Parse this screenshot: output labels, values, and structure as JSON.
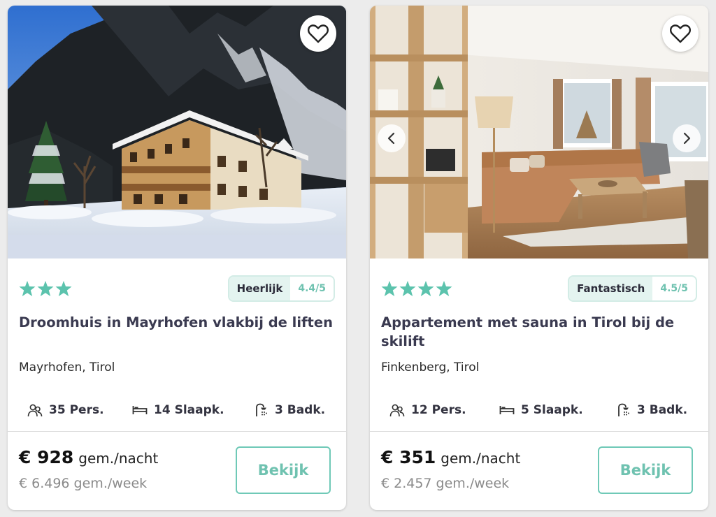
{
  "theme": {
    "accent": "#6fc2b0",
    "star_color": "#5cc3ad",
    "badge_bg": "#e4f4f0"
  },
  "cards": [
    {
      "stars": 3,
      "rating_word": "Heerlijk",
      "rating_score": "4.4/5",
      "title": "Droomhuis in Mayrhofen vlakbij de liften",
      "location": "Mayrhofen, Tirol",
      "persons": "35 Pers.",
      "bedrooms": "14 Slaapk.",
      "bathrooms": "3 Badk.",
      "price_amount": "€ 928",
      "price_unit": "gem./nacht",
      "price_week": "€ 6.496 gem./week",
      "cta": "Bekijk",
      "photo": "snowy-chalet",
      "has_carousel_arrows": false,
      "favorite_icon": "heart-outline-icon"
    },
    {
      "stars": 4,
      "rating_word": "Fantastisch",
      "rating_score": "4.5/5",
      "title": "Appartement met sauna in Tirol bij de skilift",
      "location": "Finkenberg, Tirol",
      "persons": "12 Pers.",
      "bedrooms": "5 Slaapk.",
      "bathrooms": "3 Badk.",
      "price_amount": "€ 351",
      "price_unit": "gem./nacht",
      "price_week": "€ 2.457 gem./week",
      "cta": "Bekijk",
      "photo": "living-room",
      "has_carousel_arrows": true,
      "favorite_icon": "heart-outline-icon"
    }
  ]
}
